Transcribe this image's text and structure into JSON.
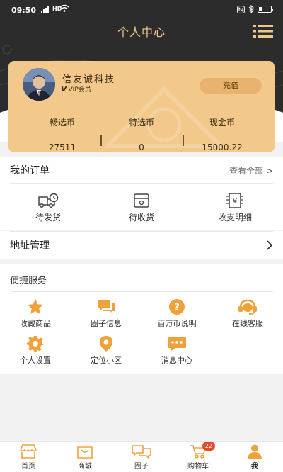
{
  "status_bar": {
    "time": "09:50",
    "network": "HD"
  },
  "header": {
    "title": "个人中心"
  },
  "profile": {
    "name": "信友诚科技",
    "vip_label": "VIP会员",
    "recharge_label": "充值",
    "wallet": [
      {
        "label": "畅选币",
        "value": "27511"
      },
      {
        "label": "特选币",
        "value": "0"
      },
      {
        "label": "现金币",
        "value": "15000.22"
      }
    ]
  },
  "orders": {
    "title": "我的订单",
    "see_all": "查看全部 >",
    "items": [
      {
        "label": "待发货",
        "icon": "truck-icon"
      },
      {
        "label": "待收货",
        "icon": "package-icon"
      },
      {
        "label": "收支明细",
        "icon": "ledger-icon"
      }
    ]
  },
  "address": {
    "label": "地址管理"
  },
  "services": {
    "title": "便捷服务",
    "items": [
      {
        "label": "收藏商品",
        "icon": "star-icon"
      },
      {
        "label": "圈子信息",
        "icon": "chat-icon"
      },
      {
        "label": "百万币说明",
        "icon": "help-icon"
      },
      {
        "label": "在线客服",
        "icon": "headset-icon"
      },
      {
        "label": "个人设置",
        "icon": "gear-icon"
      },
      {
        "label": "定位小区",
        "icon": "location-icon"
      },
      {
        "label": "消息中心",
        "icon": "message-icon"
      }
    ]
  },
  "tabbar": {
    "items": [
      {
        "label": "首页",
        "icon": "home-icon"
      },
      {
        "label": "商城",
        "icon": "mall-icon"
      },
      {
        "label": "圈子",
        "icon": "circle-icon"
      },
      {
        "label": "购物车",
        "icon": "cart-icon",
        "badge": "22"
      },
      {
        "label": "我",
        "icon": "user-icon",
        "active": true
      }
    ]
  },
  "colors": {
    "gold": "#f2c98a",
    "accent_orange": "#f0a23a",
    "dark": "#2c2c2c",
    "badge": "#e24a2c"
  }
}
